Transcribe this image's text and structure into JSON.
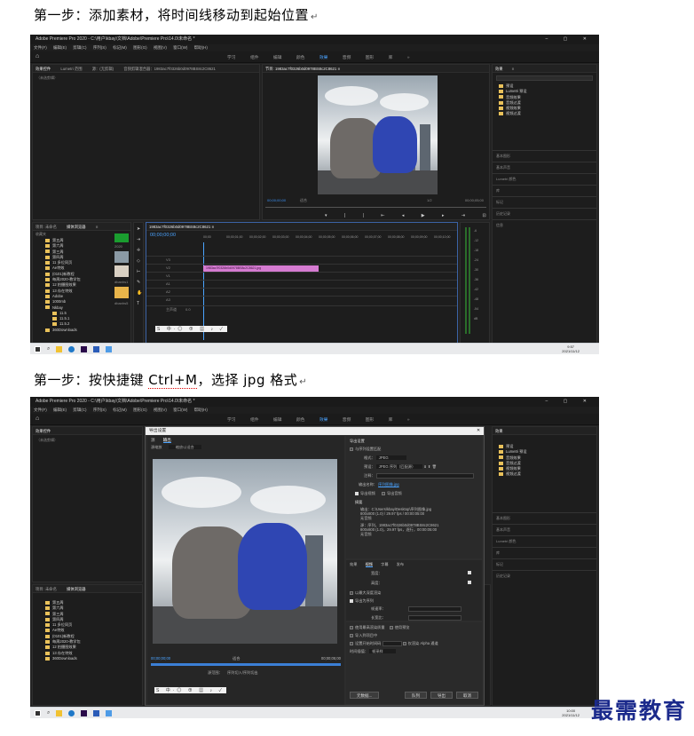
{
  "doc": {
    "step1_title": "第一步：添加素材，将时间线移动到起始位置",
    "step2_prefix": "第一步：按快捷键 ",
    "step2_hotkey": "Ctrl+M",
    "step2_suffix": "，选择 jpg 格式",
    "return_mark": "↵",
    "watermark": "最需教育"
  },
  "shot1": {
    "window_title": "Adobe Premiere Pro 2020 - C:\\用户\\kbay\\文档\\Adobe\\Premiere Pro\\14.0\\未命名 *",
    "win_controls": "– ▢ ✕",
    "menus": [
      "文件(F)",
      "编辑(E)",
      "剪辑(C)",
      "序列(S)",
      "标记(M)",
      "图形(G)",
      "视图(V)",
      "窗口(W)",
      "帮助(H)"
    ],
    "workspace_tabs": [
      "学习",
      "组件",
      "编辑",
      "颜色",
      "效果",
      "音频",
      "图形",
      "库",
      "»"
    ],
    "source_tabs": [
      "效果控件",
      "Lumetri 范围",
      "源：(无剪辑)",
      "音频剪辑混合器：1983ac7f0326b0d0978BS8c2C8621"
    ],
    "no_clip": "（未选剪辑）",
    "program_title": "节目: 1983ac7f0326b0d0978BS8c2C8621 ≡",
    "timecode_left": "00;00;00;00",
    "fit": "适合",
    "quality": "1/2",
    "timecode_right": "00;00;05;00",
    "effects_tabs": [
      "效果",
      "≡"
    ],
    "effects_items": [
      "预设",
      "Lumetri 预设",
      "音频效果",
      "音频过渡",
      "视频效果",
      "视频过渡"
    ],
    "side_panels": [
      "基本图形",
      "基本声音",
      "Lumetri 颜色",
      "库",
      "标记",
      "历史记录",
      "信息"
    ],
    "project_tabs": [
      "项目: 未命名",
      "媒体浏览器",
      "≡"
    ],
    "favorites": "收藏夹",
    "folders": [
      "第五周",
      "第六周",
      "第三周",
      "第四周",
      "11 多位同页",
      "Ae特效",
      "(0101)新教程",
      "每周2020-教学包",
      "12 拍摄图效果",
      "13 存在特效",
      "Adobe",
      "1000mb",
      "Nkbay",
      "11.5",
      "11.5.1",
      "11.5.2",
      "360Downloads"
    ],
    "thumb_labels": [
      "2020",
      "dbanhs1",
      "dbanhs5"
    ],
    "seq_tab": "1983ac7f0326b0d0978BS8c2C8621 ≡",
    "seq_timecode": "00;00;00;00",
    "ruler": [
      "00;00",
      "00;00;01;00",
      "00;00;02;00",
      "00;00;03;00",
      "00;00;04;00",
      "00;00;05;00",
      "00;00;06;00",
      "00;00;07;00",
      "00;00;08;00",
      "00;00;09;00",
      "00;00;10;00"
    ],
    "tracks": [
      "V3",
      "V2",
      "V1",
      "A1",
      "A2",
      "A3",
      "主声道"
    ],
    "clip_name": "1983ac7f0326b0d0978BS8c2C8621.jpg",
    "master_val": "0.0",
    "meter_scale": [
      "-6",
      "-12",
      "-18",
      "-24",
      "-30",
      "-36",
      "-42",
      "-48",
      "-54",
      "dB"
    ],
    "status_text": "单击以选择，或单击空白处并拖动以进行框选。使用 Shift、Alt 和 Ctrl 可获得其他选项。",
    "clock_time": "9:57",
    "clock_date": "2021/11/12"
  },
  "shot2": {
    "window_title": "Adobe Premiere Pro 2020 - C:\\用户\\kbay\\文档\\Adobe\\Premiere Pro\\14.0\\未命名 *",
    "dialog_title": "导出设置",
    "dialog_tabs": [
      "源",
      "输出"
    ],
    "source_scale_label": "源缩放",
    "source_scale_value": "缩放以适合",
    "export_settings_header": "导出设置",
    "match_seq": "与序列设置匹配",
    "format_label": "格式：",
    "format_value": "JPEG",
    "preset_label": "预设：",
    "preset_value": "JPEG 序列（匹配源）",
    "comments_label": "注释：",
    "output_name_label": "输出名称：",
    "output_name_value": "序列图像.jpg",
    "export_video": "导出视频",
    "export_audio": "导出音频",
    "summary_header": "摘要",
    "summary_out": "输出：C:\\Users\\kbay\\Desktop\\序列图像.jpg",
    "summary_out2": "800x800 (1.0) / 29.97 fps / 00:00:05:00",
    "summary_out3": "无音频",
    "summary_src": "源：序列，1983ac7f0326b0d0978BS8c2C8621",
    "summary_src2": "800x800 (1.0)，29.97 fps，逐行，00:00:05:00",
    "summary_src3": "无音频",
    "settings_tabs": [
      "效果",
      "视频",
      "字幕",
      "发布"
    ],
    "width_label": "宽度：",
    "height_label": "高度：",
    "render_max": "以最大深度渲染",
    "export_as_seq": "导出为序列",
    "field_order": "帧速率：",
    "aspect": "长宽比：",
    "use_max_quality": "使用最高渲染质量",
    "use_previews": "使用预览",
    "import_project": "导入到项目中",
    "set_timecode": "设置开始时间码",
    "time_interp_label": "时间插值：",
    "time_interp_value": "帧采样",
    "render_alpha": "仅渲染 Alpha 通道",
    "buttons": [
      "元数据...",
      "队列",
      "导出",
      "取消"
    ],
    "tc_left": "00;00;00;00",
    "fit": "适合",
    "tc_right": "00;00;05;00",
    "source_range_label": "源范围：",
    "source_range_value": "序列切入/序列切出",
    "clock_time": "10:00",
    "clock_date": "2021/11/12"
  }
}
